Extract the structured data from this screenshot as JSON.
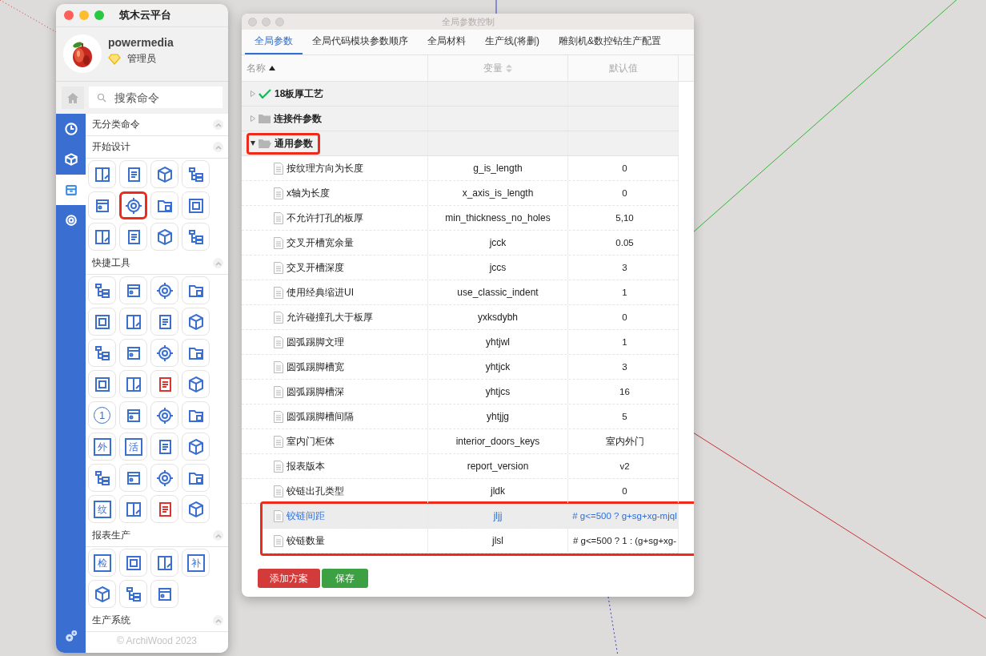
{
  "launcher": {
    "title": "筑木云平台",
    "user": {
      "name": "powermedia",
      "role": "管理员"
    },
    "search": {
      "placeholder": "搜索命令"
    },
    "tabs": [
      {
        "selected": false
      },
      {
        "selected": false
      },
      {
        "selected": true
      },
      {
        "selected": false
      }
    ],
    "sections": [
      {
        "title": "无分类命令"
      },
      {
        "title": "开始设计",
        "tools": [
          {
            "kind": "icon",
            "color": "#3a6fd1",
            "highlighted": false
          },
          {
            "kind": "icon",
            "color": "#3a6fd1",
            "highlighted": false
          },
          {
            "kind": "icon",
            "color": "#3a6fd1",
            "highlighted": false
          },
          {
            "kind": "icon",
            "color": "#3a6fd1",
            "highlighted": false
          },
          {
            "kind": "icon",
            "color": "#3a6fd1",
            "highlighted": false
          },
          {
            "kind": "icon",
            "color": "#3a6fd1",
            "highlighted": true
          },
          {
            "kind": "icon",
            "color": "#3a6fd1",
            "highlighted": false
          },
          {
            "kind": "icon",
            "color": "#3a6fd1",
            "highlighted": false
          },
          {
            "kind": "icon",
            "color": "#3a6fd1",
            "highlighted": false
          },
          {
            "kind": "icon",
            "color": "#3a6fd1",
            "highlighted": false
          },
          {
            "kind": "icon",
            "color": "#3a6fd1",
            "highlighted": false
          },
          {
            "kind": "icon",
            "color": "#3a6fd1",
            "highlighted": false
          }
        ]
      },
      {
        "title": "快捷工具",
        "tools": [
          {
            "kind": "icon",
            "color": "#3a6fd1",
            "highlighted": false
          },
          {
            "kind": "icon",
            "color": "#3a6fd1",
            "highlighted": false
          },
          {
            "kind": "icon",
            "color": "#3a6fd1",
            "highlighted": false
          },
          {
            "kind": "icon",
            "color": "#3a6fd1",
            "highlighted": false
          },
          {
            "kind": "icon",
            "color": "#3a6fd1",
            "highlighted": false
          },
          {
            "kind": "icon",
            "color": "#3a6fd1",
            "highlighted": false
          },
          {
            "kind": "icon",
            "color": "#3a6fd1",
            "highlighted": false
          },
          {
            "kind": "icon",
            "color": "#3a6fd1",
            "highlighted": false
          },
          {
            "kind": "icon",
            "color": "#3a6fd1",
            "highlighted": false
          },
          {
            "kind": "icon",
            "color": "#3a6fd1",
            "highlighted": false
          },
          {
            "kind": "icon",
            "color": "#3a6fd1",
            "highlighted": false
          },
          {
            "kind": "icon",
            "color": "#3a6fd1",
            "highlighted": false
          },
          {
            "kind": "icon",
            "color": "#3a6fd1",
            "highlighted": false
          },
          {
            "kind": "icon",
            "color": "#3a6fd1",
            "highlighted": false
          },
          {
            "kind": "icon",
            "color": "#e0322a",
            "highlighted": false
          },
          {
            "kind": "icon",
            "color": "#3a6fd1",
            "highlighted": false
          },
          {
            "kind": "circle",
            "label": "1",
            "color": "#3a6fd1",
            "highlighted": false
          },
          {
            "kind": "icon",
            "color": "#3a6fd1",
            "highlighted": false
          },
          {
            "kind": "icon",
            "color": "#3a6fd1",
            "highlighted": false
          },
          {
            "kind": "icon",
            "color": "#3a6fd1",
            "highlighted": false
          },
          {
            "kind": "text",
            "label": "外",
            "color": "#3a6fd1",
            "highlighted": false
          },
          {
            "kind": "text",
            "label": "活",
            "color": "#3a6fd1",
            "highlighted": false
          },
          {
            "kind": "icon",
            "color": "#3a6fd1",
            "highlighted": false
          },
          {
            "kind": "icon",
            "color": "#3a6fd1",
            "highlighted": false
          },
          {
            "kind": "icon",
            "color": "#3a6fd1",
            "highlighted": false
          },
          {
            "kind": "icon",
            "color": "#3a6fd1",
            "highlighted": false
          },
          {
            "kind": "icon",
            "color": "#3a6fd1",
            "highlighted": false
          },
          {
            "kind": "icon",
            "color": "#3a6fd1",
            "highlighted": false
          },
          {
            "kind": "text",
            "label": "纹",
            "color": "#3a6fd1",
            "highlighted": false
          },
          {
            "kind": "icon",
            "color": "#3a6fd1",
            "highlighted": false
          },
          {
            "kind": "icon",
            "color": "#e0322a",
            "highlighted": false
          },
          {
            "kind": "icon",
            "color": "#3a6fd1",
            "highlighted": false
          }
        ]
      },
      {
        "title": "报表生产",
        "tools": [
          {
            "kind": "text",
            "label": "检",
            "color": "#3a6fd1",
            "highlighted": false
          },
          {
            "kind": "icon",
            "color": "#3a6fd1",
            "highlighted": false
          },
          {
            "kind": "icon",
            "color": "#3a6fd1",
            "highlighted": false
          },
          {
            "kind": "text",
            "label": "补",
            "color": "#3a6fd1",
            "highlighted": false
          },
          {
            "kind": "icon",
            "color": "#3a6fd1",
            "highlighted": false
          },
          {
            "kind": "icon",
            "color": "#3a6fd1",
            "highlighted": false
          },
          {
            "kind": "icon",
            "color": "#3a6fd1",
            "highlighted": false
          }
        ]
      },
      {
        "title": "生产系统"
      }
    ],
    "footer": "© ArchiWood 2023"
  },
  "dialog": {
    "title": "全局参数控制",
    "tabs": [
      {
        "label": "全局参数",
        "selected": true
      },
      {
        "label": "全局代码模块参数顺序",
        "selected": false
      },
      {
        "label": "全局材料",
        "selected": false
      },
      {
        "label": "生产线(将删)",
        "selected": false
      },
      {
        "label": "雕刻机&数控钻生产配置",
        "selected": false
      }
    ],
    "table": {
      "columns": [
        {
          "label": "名称",
          "sorted": true
        },
        {
          "label": "变量",
          "sorted": false
        },
        {
          "label": "默认值"
        }
      ],
      "rows": [
        {
          "name": "18板厚工艺",
          "kind": "check",
          "expanded": false,
          "highlighted": false
        },
        {
          "name": "连接件参数",
          "kind": "folder",
          "expanded": false,
          "highlighted": false
        },
        {
          "name": "通用参数",
          "kind": "folder",
          "expanded": true,
          "highlighted": true,
          "children": [
            {
              "name": "按纹理方向为长度",
              "variable": "g_is_length",
              "default": "0",
              "selected": false,
              "highlighted": false
            },
            {
              "name": "x轴为长度",
              "variable": "x_axis_is_length",
              "default": "0",
              "selected": false,
              "highlighted": false
            },
            {
              "name": "不允许打孔的板厚",
              "variable": "min_thickness_no_holes",
              "default": "5,10",
              "selected": false,
              "highlighted": false
            },
            {
              "name": "交叉开槽宽余量",
              "variable": "jcck",
              "default": "0.05",
              "selected": false,
              "highlighted": false
            },
            {
              "name": "交叉开槽深度",
              "variable": "jccs",
              "default": "3",
              "selected": false,
              "highlighted": false
            },
            {
              "name": "使用经典缩进UI",
              "variable": "use_classic_indent",
              "default": "1",
              "selected": false,
              "highlighted": false
            },
            {
              "name": "允许碰撞孔大于板厚",
              "variable": "yxksdybh",
              "default": "0",
              "selected": false,
              "highlighted": false
            },
            {
              "name": "圆弧踢脚文理",
              "variable": "yhtjwl",
              "default": "1",
              "selected": false,
              "highlighted": false
            },
            {
              "name": "圆弧踢脚槽宽",
              "variable": "yhtjck",
              "default": "3",
              "selected": false,
              "highlighted": false
            },
            {
              "name": "圆弧踢脚槽深",
              "variable": "yhtjcs",
              "default": "16",
              "selected": false,
              "highlighted": false
            },
            {
              "name": "圆弧踢脚槽间隔",
              "variable": "yhtjjg",
              "default": "5",
              "selected": false,
              "highlighted": false
            },
            {
              "name": "室内门柜体",
              "variable": "interior_doors_keys",
              "default": "室内外门",
              "selected": false,
              "highlighted": false
            },
            {
              "name": "报表版本",
              "variable": "report_version",
              "default": "v2",
              "selected": false,
              "highlighted": false
            },
            {
              "name": "铰链出孔类型",
              "variable": "jldk",
              "default": "0",
              "selected": false,
              "highlighted": false
            },
            {
              "name": "铰链间距",
              "variable": "jljj",
              "default": "# g<=500 ? g+sg+xg-mjql",
              "selected": true,
              "highlighted": true
            },
            {
              "name": "铰链数量",
              "variable": "jlsl",
              "default": "# g<=500 ? 1 : (g+sg+xg-",
              "selected": false,
              "highlighted": true
            }
          ]
        }
      ]
    },
    "buttons": [
      {
        "label": "添加方案",
        "kind": "danger"
      },
      {
        "label": "保存",
        "kind": "success"
      }
    ]
  }
}
